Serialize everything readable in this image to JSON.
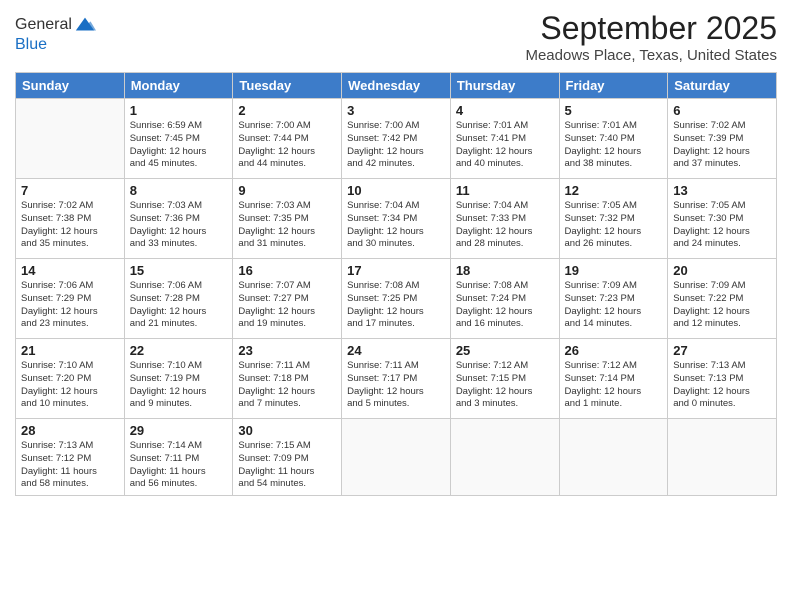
{
  "header": {
    "logo_line1": "General",
    "logo_line2": "Blue",
    "month_title": "September 2025",
    "location": "Meadows Place, Texas, United States"
  },
  "weekdays": [
    "Sunday",
    "Monday",
    "Tuesday",
    "Wednesday",
    "Thursday",
    "Friday",
    "Saturday"
  ],
  "weeks": [
    [
      {
        "day": "",
        "info": ""
      },
      {
        "day": "1",
        "info": "Sunrise: 6:59 AM\nSunset: 7:45 PM\nDaylight: 12 hours\nand 45 minutes."
      },
      {
        "day": "2",
        "info": "Sunrise: 7:00 AM\nSunset: 7:44 PM\nDaylight: 12 hours\nand 44 minutes."
      },
      {
        "day": "3",
        "info": "Sunrise: 7:00 AM\nSunset: 7:42 PM\nDaylight: 12 hours\nand 42 minutes."
      },
      {
        "day": "4",
        "info": "Sunrise: 7:01 AM\nSunset: 7:41 PM\nDaylight: 12 hours\nand 40 minutes."
      },
      {
        "day": "5",
        "info": "Sunrise: 7:01 AM\nSunset: 7:40 PM\nDaylight: 12 hours\nand 38 minutes."
      },
      {
        "day": "6",
        "info": "Sunrise: 7:02 AM\nSunset: 7:39 PM\nDaylight: 12 hours\nand 37 minutes."
      }
    ],
    [
      {
        "day": "7",
        "info": "Sunrise: 7:02 AM\nSunset: 7:38 PM\nDaylight: 12 hours\nand 35 minutes."
      },
      {
        "day": "8",
        "info": "Sunrise: 7:03 AM\nSunset: 7:36 PM\nDaylight: 12 hours\nand 33 minutes."
      },
      {
        "day": "9",
        "info": "Sunrise: 7:03 AM\nSunset: 7:35 PM\nDaylight: 12 hours\nand 31 minutes."
      },
      {
        "day": "10",
        "info": "Sunrise: 7:04 AM\nSunset: 7:34 PM\nDaylight: 12 hours\nand 30 minutes."
      },
      {
        "day": "11",
        "info": "Sunrise: 7:04 AM\nSunset: 7:33 PM\nDaylight: 12 hours\nand 28 minutes."
      },
      {
        "day": "12",
        "info": "Sunrise: 7:05 AM\nSunset: 7:32 PM\nDaylight: 12 hours\nand 26 minutes."
      },
      {
        "day": "13",
        "info": "Sunrise: 7:05 AM\nSunset: 7:30 PM\nDaylight: 12 hours\nand 24 minutes."
      }
    ],
    [
      {
        "day": "14",
        "info": "Sunrise: 7:06 AM\nSunset: 7:29 PM\nDaylight: 12 hours\nand 23 minutes."
      },
      {
        "day": "15",
        "info": "Sunrise: 7:06 AM\nSunset: 7:28 PM\nDaylight: 12 hours\nand 21 minutes."
      },
      {
        "day": "16",
        "info": "Sunrise: 7:07 AM\nSunset: 7:27 PM\nDaylight: 12 hours\nand 19 minutes."
      },
      {
        "day": "17",
        "info": "Sunrise: 7:08 AM\nSunset: 7:25 PM\nDaylight: 12 hours\nand 17 minutes."
      },
      {
        "day": "18",
        "info": "Sunrise: 7:08 AM\nSunset: 7:24 PM\nDaylight: 12 hours\nand 16 minutes."
      },
      {
        "day": "19",
        "info": "Sunrise: 7:09 AM\nSunset: 7:23 PM\nDaylight: 12 hours\nand 14 minutes."
      },
      {
        "day": "20",
        "info": "Sunrise: 7:09 AM\nSunset: 7:22 PM\nDaylight: 12 hours\nand 12 minutes."
      }
    ],
    [
      {
        "day": "21",
        "info": "Sunrise: 7:10 AM\nSunset: 7:20 PM\nDaylight: 12 hours\nand 10 minutes."
      },
      {
        "day": "22",
        "info": "Sunrise: 7:10 AM\nSunset: 7:19 PM\nDaylight: 12 hours\nand 9 minutes."
      },
      {
        "day": "23",
        "info": "Sunrise: 7:11 AM\nSunset: 7:18 PM\nDaylight: 12 hours\nand 7 minutes."
      },
      {
        "day": "24",
        "info": "Sunrise: 7:11 AM\nSunset: 7:17 PM\nDaylight: 12 hours\nand 5 minutes."
      },
      {
        "day": "25",
        "info": "Sunrise: 7:12 AM\nSunset: 7:15 PM\nDaylight: 12 hours\nand 3 minutes."
      },
      {
        "day": "26",
        "info": "Sunrise: 7:12 AM\nSunset: 7:14 PM\nDaylight: 12 hours\nand 1 minute."
      },
      {
        "day": "27",
        "info": "Sunrise: 7:13 AM\nSunset: 7:13 PM\nDaylight: 12 hours\nand 0 minutes."
      }
    ],
    [
      {
        "day": "28",
        "info": "Sunrise: 7:13 AM\nSunset: 7:12 PM\nDaylight: 11 hours\nand 58 minutes."
      },
      {
        "day": "29",
        "info": "Sunrise: 7:14 AM\nSunset: 7:11 PM\nDaylight: 11 hours\nand 56 minutes."
      },
      {
        "day": "30",
        "info": "Sunrise: 7:15 AM\nSunset: 7:09 PM\nDaylight: 11 hours\nand 54 minutes."
      },
      {
        "day": "",
        "info": ""
      },
      {
        "day": "",
        "info": ""
      },
      {
        "day": "",
        "info": ""
      },
      {
        "day": "",
        "info": ""
      }
    ]
  ]
}
